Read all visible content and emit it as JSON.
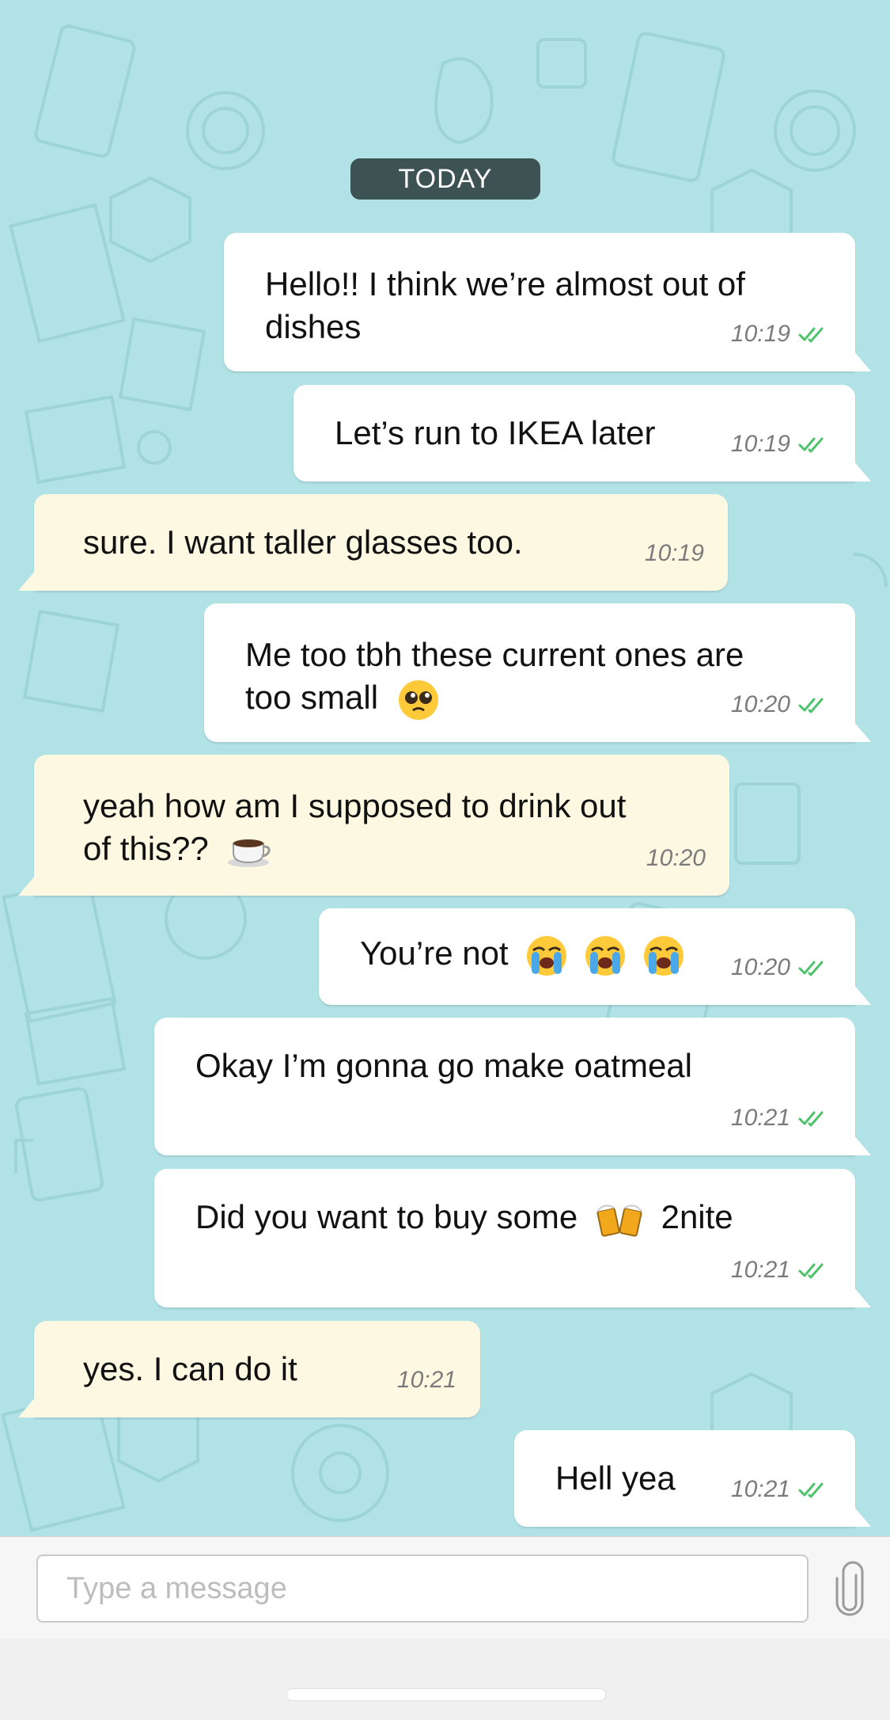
{
  "date_separator": "TODAY",
  "messages": [
    {
      "direction": "out",
      "lines": [
        "Hello!! I think we’re almost out of",
        "dishes"
      ],
      "time": "10:19",
      "status": "read"
    },
    {
      "direction": "out",
      "lines": [
        "Let’s run to IKEA later"
      ],
      "time": "10:19",
      "status": "read"
    },
    {
      "direction": "in",
      "lines": [
        "sure. I want taller glasses too."
      ],
      "time": "10:19"
    },
    {
      "direction": "out",
      "lines": [
        "Me too tbh these current ones are",
        "too small"
      ],
      "emoji": "pleading-face",
      "time": "10:20",
      "status": "read"
    },
    {
      "direction": "in",
      "lines": [
        "yeah how am I supposed to drink out",
        "of this??"
      ],
      "emoji": "hot-beverage",
      "time": "10:20"
    },
    {
      "direction": "out",
      "lines": [
        "You’re not"
      ],
      "emoji": "loudly-crying-face x3",
      "time": "10:20",
      "status": "read"
    },
    {
      "direction": "out",
      "lines": [
        "Okay I’m gonna go make oatmeal"
      ],
      "time": "10:21",
      "status": "read"
    },
    {
      "direction": "out",
      "lines": [
        "Did you want to buy some",
        "2nite"
      ],
      "emoji": "clinking-beer-mugs",
      "time": "10:21",
      "status": "read"
    },
    {
      "direction": "in",
      "lines": [
        "yes. I can do it"
      ],
      "time": "10:21"
    },
    {
      "direction": "out",
      "lines": [
        "Hell yea"
      ],
      "time": "10:21",
      "status": "read"
    }
  ],
  "composer": {
    "placeholder": "Type a message",
    "attach_icon": "paperclip-icon"
  },
  "colors": {
    "wallpaper": "#b0e2e6",
    "outgoing_bubble": "#ffffff",
    "incoming_bubble": "#fdf8e1",
    "read_ticks": "#4fc36b",
    "date_chip": "#3c5253"
  }
}
